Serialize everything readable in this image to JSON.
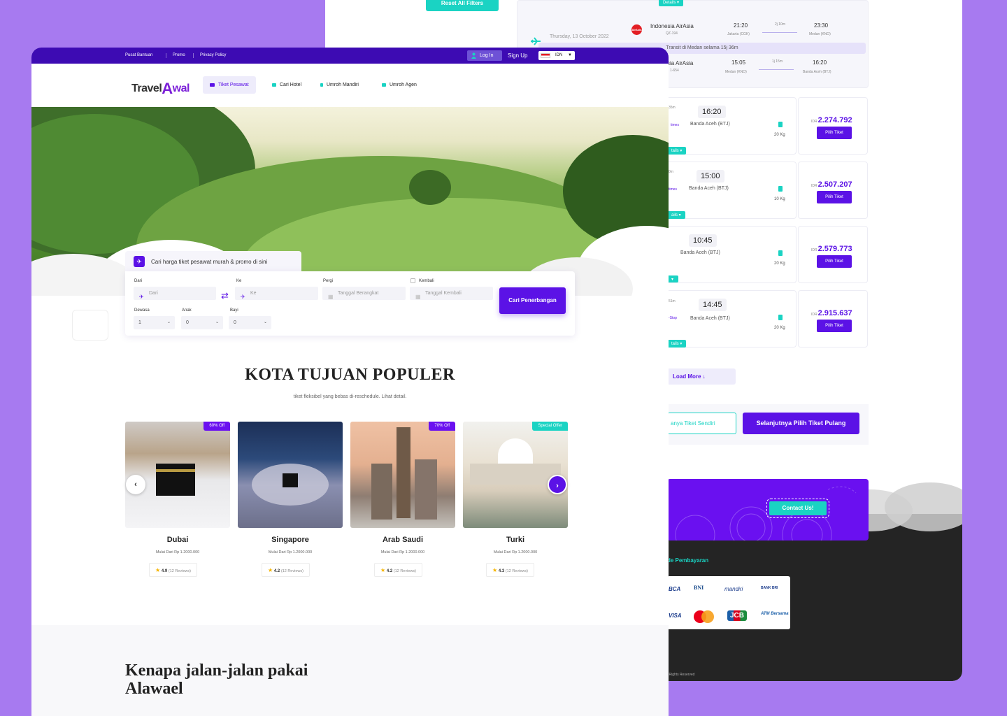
{
  "back": {
    "reset_filters": "Reset All Filters",
    "details_label": "Details",
    "itinerary": {
      "date": "Thursday, 13 October 2022",
      "leg1": {
        "airline": "Indonesia AirAsia",
        "code": "QZ-194",
        "depart": "21:20",
        "depart_city": "Jakarta (CGK)",
        "duration": "2j 10m",
        "arrive": "23:30",
        "arrive_city": "Medan (KNO)"
      },
      "transit": "Transit di Medan selama 15j 36m",
      "leg2": {
        "airline": "sia AirAsia",
        "code": "1-654",
        "depart": "15:05",
        "depart_city": "Medan (KNO)",
        "duration": "1j 15m",
        "arrive": "16:20",
        "arrive_city": "Banda Aceh (BTJ)"
      }
    },
    "results": [
      {
        "dur": "35m",
        "stop": "times",
        "time": "16:20",
        "city": "Banda Aceh (BTJ)",
        "bag": "20 Kg",
        "currency": "IDR",
        "price": "2.274.792",
        "btn": "Pilih Tiket",
        "details": "tails"
      },
      {
        "dur": "0m",
        "stop": "times",
        "time": "15:00",
        "city": "Banda Aceh (BTJ)",
        "bag": "10 Kg",
        "currency": "IDR",
        "price": "2.507.207",
        "btn": "Pilih Tiket",
        "details": "ails"
      },
      {
        "dur": "",
        "stop": "",
        "time": "10:45",
        "city": "Banda Aceh (BTJ)",
        "bag": "20 Kg",
        "currency": "IDR",
        "price": "2.579.773",
        "btn": "Pilih Tiket",
        "details": ""
      },
      {
        "dur": "51m",
        "stop": "-Stop",
        "time": "14:45",
        "city": "Banda Aceh (BTJ)",
        "bag": "20 Kg",
        "currency": "IDR",
        "price": "2.915.637",
        "btn": "Pilih Tiket",
        "details": "tails"
      }
    ],
    "load_more": "Load More ↓",
    "own_ticket": "anya Tiket Sendiri",
    "next_ticket": "Selanjutnya Pilih Tiket Pulang",
    "contact": "Contact Us!",
    "payment_title": "de Pembayaran",
    "payments": [
      "BCA",
      "BNI",
      "mandiri",
      "BANK BRI",
      "VISA",
      "Mastercard",
      "JCB",
      "ATM Bersama"
    ],
    "rights": "l Rights Reserved"
  },
  "topbar": {
    "links": [
      "Pusat Bantuan",
      "Promo",
      "Privacy Policy"
    ],
    "login": "Log In",
    "signup": "Sign Up",
    "lang": "IDN"
  },
  "brand": {
    "part1": "Travel",
    "part2": "A",
    "part3": "wal"
  },
  "menu": [
    {
      "label": "Tiket Pesawat",
      "icon": "plane-icon"
    },
    {
      "label": "Cari Hotel",
      "icon": "hotel-icon"
    },
    {
      "label": "Umroh Mandiri",
      "icon": "person-icon"
    },
    {
      "label": "Umroh Agen",
      "icon": "group-icon"
    }
  ],
  "search": {
    "tab": "Cari harga tiket pesawat murah & promo di sini",
    "from_label": "Dari",
    "from_placeholder": "Dari",
    "to_label": "Ke",
    "to_placeholder": "Ke",
    "depart_label": "Pergi",
    "depart_placeholder": "Tanggal Berangkat",
    "return_label": "Kembali",
    "return_placeholder": "Tanggal Kembali",
    "adult_label": "Dewasa",
    "adult_value": "1",
    "child_label": "Anak",
    "child_value": "0",
    "infant_label": "Bayi",
    "infant_value": "0",
    "button": "Cari Penerbangan"
  },
  "popular": {
    "title": "KOTA TUJUAN POPULER",
    "subtitle": "tiket fleksibel yang bebas di-reschedule. Lihat detail.",
    "items": [
      {
        "name": "Dubai",
        "price": "Mulai Dari Rp 1.2000.000",
        "rating": "4.9",
        "reviews": "(12 Reviews)",
        "badge": "60% Off",
        "badge_color": "#6a10f0"
      },
      {
        "name": "Singapore",
        "price": "Mulai Dari Rp 1.2000.000",
        "rating": "4.2",
        "reviews": "(12 Reviews)",
        "badge": "",
        "badge_color": ""
      },
      {
        "name": "Arab Saudi",
        "price": "Mulai Dari Rp 1.2000.000",
        "rating": "4.2",
        "reviews": "(12 Reviews)",
        "badge": "70% Off",
        "badge_color": "#6a10f0"
      },
      {
        "name": "Turki",
        "price": "Mulai Dari Rp 1.2000.000",
        "rating": "4.3",
        "reviews": "(12 Reviews)",
        "badge": "Special Offer",
        "badge_color": "#1ad3c3"
      }
    ]
  },
  "why": {
    "title_line1": "Kenapa jalan-jalan pakai",
    "title_line2": "Alawael"
  },
  "colors": {
    "primary": "#5b12e6",
    "accent": "#1ad3c3",
    "topbar": "#3d0bb3",
    "background": "#a77af0"
  }
}
